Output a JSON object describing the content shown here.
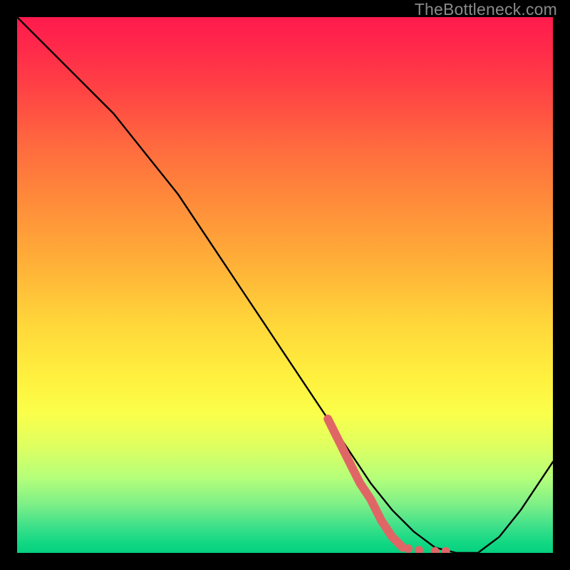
{
  "watermark": "TheBottleneck.com",
  "chart_data": {
    "type": "line",
    "title": "",
    "xlabel": "",
    "ylabel": "",
    "x_range": [
      0,
      100
    ],
    "y_range": [
      0,
      100
    ],
    "series": [
      {
        "name": "bottleneck-curve",
        "color": "#000000",
        "x": [
          0,
          6,
          12,
          18,
          22,
          26,
          30,
          34,
          38,
          42,
          46,
          50,
          54,
          58,
          62,
          66,
          70,
          74,
          78,
          82,
          86,
          90,
          94,
          98,
          100
        ],
        "y": [
          100,
          94,
          88,
          82,
          77,
          72,
          67,
          61,
          55,
          49,
          43,
          37,
          31,
          25,
          19,
          13,
          8,
          4,
          1,
          0,
          0,
          3,
          8,
          14,
          17
        ]
      },
      {
        "name": "highlight-segment",
        "color": "#e06666",
        "style": "thick",
        "x": [
          58,
          60,
          62,
          64,
          66,
          68,
          70,
          72
        ],
        "y": [
          25,
          21,
          17,
          13,
          10,
          6,
          3,
          1
        ]
      },
      {
        "name": "highlight-dots",
        "color": "#e06666",
        "style": "dots",
        "x": [
          73,
          75,
          78,
          80
        ],
        "y": [
          0.8,
          0.5,
          0.3,
          0.3
        ]
      }
    ],
    "gradient_bg": {
      "top": "#ff1a4d",
      "mid": "#ffe03c",
      "bottom": "#05d07e"
    }
  }
}
